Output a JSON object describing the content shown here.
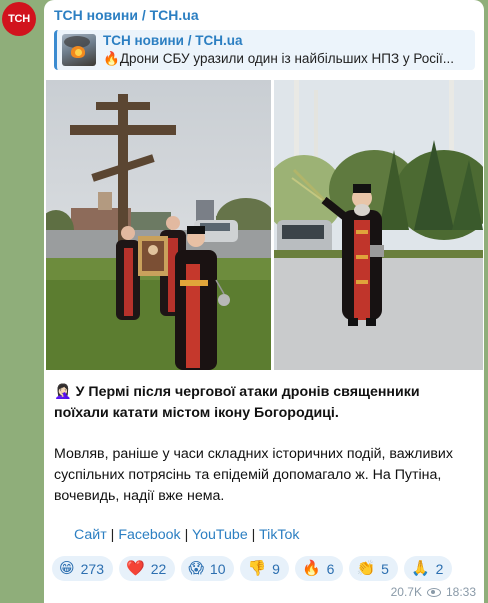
{
  "channel": {
    "avatar_text": "ТСН",
    "name": "ТСН новини / ТСН.ua"
  },
  "reply": {
    "title": "ТСН новини / ТСН.ua",
    "emoji": "🔥",
    "text": "Дрони СБУ уразили один із найбільших НПЗ у Росії..."
  },
  "post": {
    "emoji": "🤦🏻‍♀️",
    "headline": "У Пермі після чергової атаки дронів священники поїхали катати містом ікону Богородиці.",
    "body": "Мовляв, раніше у часи складних історичних подій, важливих суспільних потрясінь та епідемій допомагало ж. На Путіна, вочевидь, надії вже нема."
  },
  "links": [
    {
      "label": "Сайт"
    },
    {
      "label": "Facebook"
    },
    {
      "label": "YouTube"
    },
    {
      "label": "TikTok"
    }
  ],
  "reactions": [
    {
      "emoji": "😁",
      "count": "273"
    },
    {
      "emoji": "❤️",
      "count": "22"
    },
    {
      "emoji": "😱",
      "count": "10"
    },
    {
      "emoji": "👎",
      "count": "9"
    },
    {
      "emoji": "🔥",
      "count": "6"
    },
    {
      "emoji": "👏",
      "count": "5"
    },
    {
      "emoji": "🙏",
      "count": "2"
    }
  ],
  "meta": {
    "views": "20.7K",
    "time": "18:33",
    "views_icon": "eye-icon"
  },
  "colors": {
    "accent": "#2c7fc2",
    "avatar_bg": "#d1131d",
    "reaction_bg": "#e7f1fa",
    "chat_bg": "#8fae7a"
  }
}
